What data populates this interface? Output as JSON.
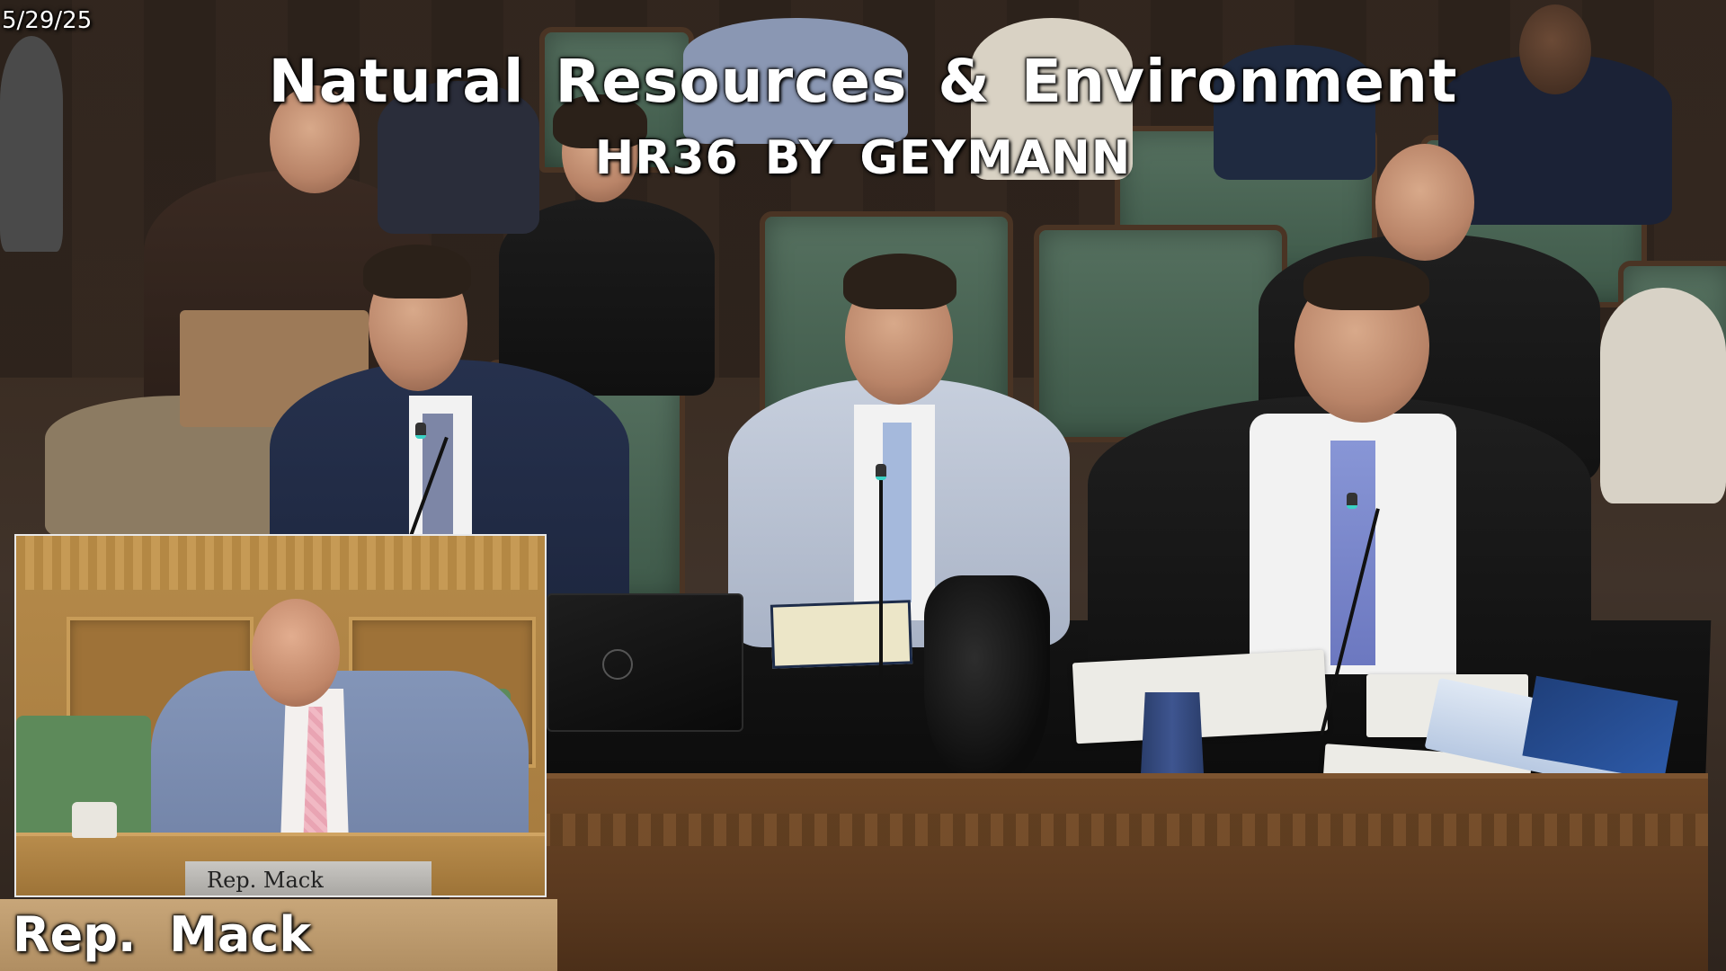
{
  "broadcast": {
    "date": "5/29/25",
    "title": "Natural Resources & Environment",
    "subtitle": "HR36 BY GEYMANN",
    "speaker": "Rep. Mack"
  },
  "inset": {
    "nameplate": "Rep. Mack"
  },
  "colors": {
    "overlay_text": "#ffffff",
    "desk_wood": "#6b4525",
    "chair_green": "#4f6a58",
    "inset_border": "#e8e8e8"
  }
}
